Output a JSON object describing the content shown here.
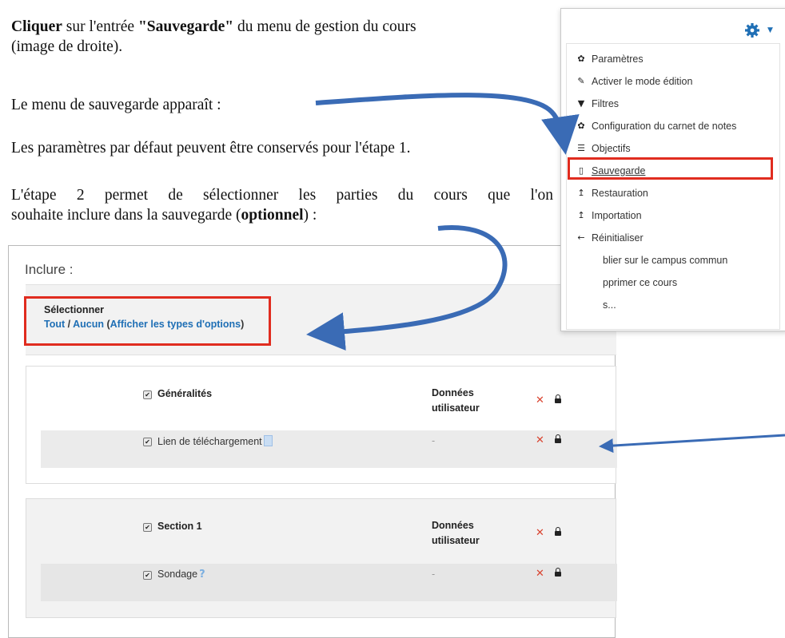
{
  "doc": {
    "line1_bold": "Cliquer",
    "line1_mid": " sur l'entrée ",
    "line1_quoted": "\"Sauvegarde\"",
    "line1_end": " du menu de gestion du cours",
    "line2": "(image de droite).",
    "line3": "Le menu de sauvegarde apparaît :",
    "line4": "Les paramètres par défaut peuvent être conservés pour l'étape 1.",
    "line5": "L'étape 2 permet de sélectionner les parties du cours que l'on",
    "line6_start": "souhaite inclure dans la sauvegarde (",
    "line6_bold": "optionnel",
    "line6_end": ") :"
  },
  "backup": {
    "title": "Inclure :",
    "select_label": "Sélectionner",
    "all": "Tout",
    "sep": " / ",
    "none": "Aucun",
    "open_paren": " (",
    "show_types": "Afficher les types d'options",
    "close_paren": ")",
    "sections": [
      {
        "title": "Généralités",
        "user_data_line1": "Données",
        "user_data_line2": "utilisateur",
        "activity": "Lien de téléchargement",
        "activity_value": "-"
      },
      {
        "title": "Section 1",
        "user_data_line1": "Données",
        "user_data_line2": "utilisateur",
        "activity": "Sondage",
        "activity_value": "-"
      }
    ]
  },
  "menu": {
    "items": [
      {
        "label": "Paramètres",
        "icon": "gear-icon"
      },
      {
        "label": "Activer le mode édition",
        "icon": "pencil-icon"
      },
      {
        "label": "Filtres",
        "icon": "filter-icon"
      },
      {
        "label": "Configuration du carnet de notes",
        "icon": "gear-icon"
      },
      {
        "label": "Objectifs",
        "icon": "list-icon"
      },
      {
        "label": "Sauvegarde",
        "icon": "file-icon"
      },
      {
        "label": "Restauration",
        "icon": "upload-icon"
      },
      {
        "label": "Importation",
        "icon": "upload-icon"
      },
      {
        "label": "Réinitialiser",
        "icon": "arrow-left-icon"
      },
      {
        "label": "blier sur le campus commun",
        "icon": ""
      },
      {
        "label": "pprimer ce cours",
        "icon": ""
      },
      {
        "label": "s...",
        "icon": ""
      }
    ]
  },
  "colors": {
    "highlight": "#e02c1f",
    "arrow": "#3a6bb5",
    "link": "#1f6fb5"
  }
}
